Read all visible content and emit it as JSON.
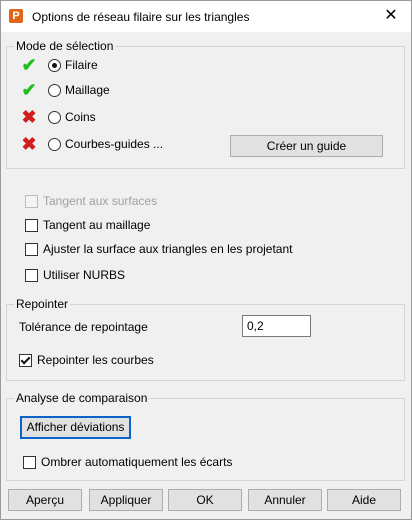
{
  "window": {
    "title": "Options de réseau filaire sur les triangles"
  },
  "icons": {
    "app": "P",
    "check": "✔",
    "cross": "✖"
  },
  "selection": {
    "title": "Mode de sélection",
    "items": [
      {
        "label": "Filaire",
        "status": "check"
      },
      {
        "label": "Maillage",
        "status": "check"
      },
      {
        "label": "Coins",
        "status": "cross"
      },
      {
        "label": "Courbes-guides ...",
        "status": "cross"
      }
    ],
    "create_guide": "Créer un guide"
  },
  "options": {
    "tangent_surfaces": "Tangent aux surfaces",
    "tangent_mesh": "Tangent au maillage",
    "adjust_surface": "Ajuster la surface aux triangles en les projetant",
    "use_nurbs": "Utiliser NURBS"
  },
  "repoint": {
    "title": "Repointer",
    "tolerance_label": "Tolérance de repointage",
    "tolerance_value": "0,2",
    "repoint_curves": "Repointer les courbes"
  },
  "analysis": {
    "title": "Analyse de comparaison",
    "show_deviations": "Afficher déviations",
    "shade_auto": "Ombrer automatiquement les écarts"
  },
  "footer": {
    "preview": "Aperçu",
    "apply": "Appliquer",
    "ok": "OK",
    "cancel": "Annuler",
    "help": "Aide"
  },
  "colors": {
    "check": "#1fbf1f",
    "cross": "#d11f1f",
    "focus": "#0a63c9"
  }
}
